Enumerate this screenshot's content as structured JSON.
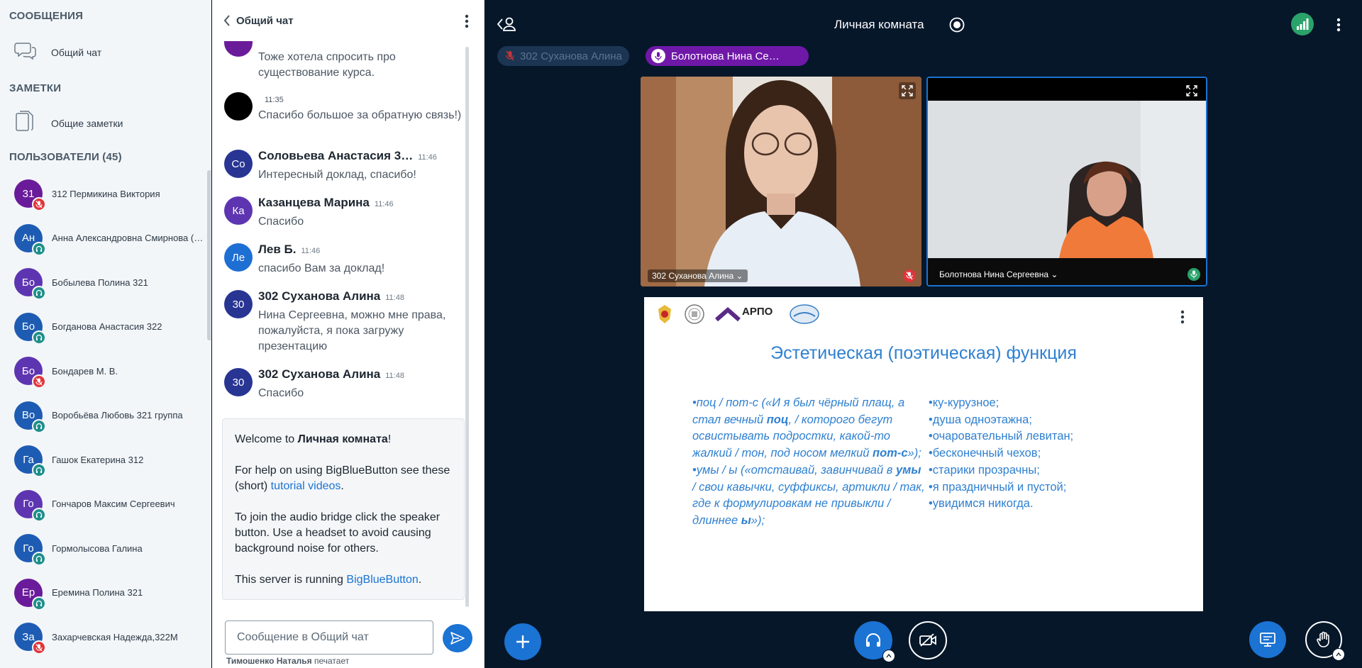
{
  "sidebar": {
    "messages_heading": "СООБЩЕНИЯ",
    "public_chat_label": "Общий чат",
    "notes_heading": "ЗАМЕТКИ",
    "shared_notes_label": "Общие заметки",
    "users_heading": "ПОЛЬЗОВАТЕЛИ (45)",
    "users": [
      {
        "initials": "31",
        "name": "312 Пермикина Виктория",
        "color": "#6a1b9a",
        "status": "muted"
      },
      {
        "initials": "Ан",
        "name": "Анна Александровна Смирнова (Кафедра русского языка и литературы)",
        "color": "#1e5cb3",
        "status": "listen"
      },
      {
        "initials": "Бо",
        "name": "Бобылева Полина 321",
        "color": "#5e35b1",
        "status": "listen"
      },
      {
        "initials": "Бо",
        "name": "Богданова Анастасия 322",
        "color": "#1e5cb3",
        "status": "listen"
      },
      {
        "initials": "Бо",
        "name": "Бондарев М. В.",
        "color": "#5e35b1",
        "status": "muted"
      },
      {
        "initials": "Во",
        "name": "Воробьёва Любовь 321 группа",
        "color": "#1e5cb3",
        "status": "listen"
      },
      {
        "initials": "Га",
        "name": "Гашок Екатерина 312",
        "color": "#1e5cb3",
        "status": "listen"
      },
      {
        "initials": "Го",
        "name": "Гончаров Максим Сергеевич",
        "color": "#5e35b1",
        "status": "listen"
      },
      {
        "initials": "Го",
        "name": "Гормолысова Галина",
        "color": "#1e5cb3",
        "status": "listen"
      },
      {
        "initials": "Ер",
        "name": "Еремина Полина 321",
        "color": "#6a1b9a",
        "status": "listen"
      },
      {
        "initials": "За",
        "name": "Захарчевская Надежда,322М",
        "color": "#1e5cb3",
        "status": "muted"
      }
    ]
  },
  "chat": {
    "title": "Общий чат",
    "messages": [
      {
        "initials": "",
        "sender": "",
        "time": "",
        "color": "#6a1b9a",
        "text": "Тоже хотела спросить про существование курса."
      },
      {
        "initials": "",
        "sender": "",
        "time": "11:35",
        "color": "#000000",
        "text": "Спасибо большое за обратную связь!)"
      },
      {
        "initials": "Со",
        "sender": "Соловьева Анастасия 3…",
        "time": "11:46",
        "color": "#283593",
        "text": "Интересный доклад, спасибо!"
      },
      {
        "initials": "Ка",
        "sender": "Казанцева Марина",
        "time": "11:46",
        "color": "#5e35b1",
        "text": "Спасибо"
      },
      {
        "initials": "Ле",
        "sender": "Лев Б.",
        "time": "11:46",
        "color": "#1e6fd3",
        "text": "спасибо Вам за доклад!"
      },
      {
        "initials": "30",
        "sender": "302 Суханова Алина",
        "time": "11:48",
        "color": "#283593",
        "text": "Нина Сергеевна, можно мне права, пожалуйста, я пока загружу презентацию"
      },
      {
        "initials": "30",
        "sender": "302 Суханова Алина",
        "time": "11:48",
        "color": "#283593",
        "text": "Спасибо"
      }
    ],
    "welcome": {
      "line1_prefix": "Welcome to ",
      "line1_room": "Личная комната",
      "line1_suffix": "!",
      "help_prefix": "For help on using BigBlueButton see these (short) ",
      "help_link": "tutorial videos",
      "help_suffix": ".",
      "audio_text": "To join the audio bridge click the speaker button. Use a headset to avoid causing background noise for others.",
      "server_prefix": "This server is running ",
      "server_link": "BigBlueButton",
      "server_suffix": "."
    },
    "input_placeholder": "Сообщение в Общий чат",
    "typing_name": "Тимошенко Наталья",
    "typing_suffix": "печатает"
  },
  "main": {
    "room_title": "Личная комната",
    "talkers": [
      {
        "name": "302 Суханова Алина",
        "state": "muted"
      },
      {
        "name": "Болотнова Нина Се…",
        "state": "talking"
      }
    ],
    "videos": [
      {
        "name": "302 Суханова Алина",
        "mic": "muted"
      },
      {
        "name": "Болотнова Нина Сергеевна",
        "mic": "talking"
      }
    ],
    "slide": {
      "logo_text": "АРПО",
      "title": "Эстетическая (поэтическая) функция",
      "left_p1_a": "•поц / пот-с («И я был чёрный плащ, а стал вечный ",
      "left_p1_b": "поц",
      "left_p1_c": ", / которого бегут освистывать подростки, какой-то жалкий / тон, под носом мелкий ",
      "left_p1_d": "пот-с",
      "left_p1_e": "»);",
      "left_p2_a": "•умы / ы («отстаивай, завинчивай в ",
      "left_p2_b": "умы",
      "left_p2_c": " / свои кавычки, суффиксы, артикли / так, где к формулировкам не привыкли / длиннее ",
      "left_p2_d": "ы",
      "left_p2_e": "»);",
      "right_lines": [
        "•ку-курузное;",
        "•душа одноэтажна;",
        "•очаровательный левитан;",
        "•бесконечный чехов;",
        "•старики прозрачны;",
        "•я праздничный и пустой;",
        "•увидимся никогда."
      ]
    }
  },
  "colors": {
    "accent": "#1b73d3",
    "main_bg": "#06172a",
    "muted_red": "#e0363b",
    "talking_purple": "#6f18a8",
    "connection_green": "#2aa36b"
  }
}
